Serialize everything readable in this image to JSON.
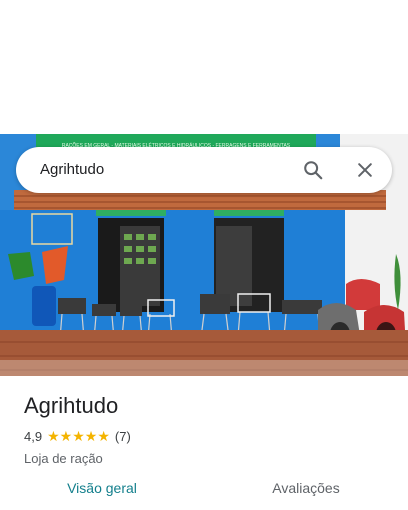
{
  "search": {
    "query": "Agrihtudo"
  },
  "place": {
    "name": "Agrihtudo",
    "rating": "4,9",
    "stars_filled": 5,
    "review_count": "(7)",
    "category": "Loja de ração"
  },
  "storefront_sign": {
    "line1": "RAÇÕES EM GERAL - MATERIAIS ELÉTRICOS E HIDRÁULICOS - FERRAGENS E FERRAMENTAS"
  },
  "tabs": [
    {
      "label": "Visão geral",
      "active": true
    },
    {
      "label": "Avaliações",
      "active": false
    }
  ],
  "colors": {
    "active_tab": "#137f8c",
    "star": "#f4b400",
    "wall_blue": "#1f7fd6"
  }
}
